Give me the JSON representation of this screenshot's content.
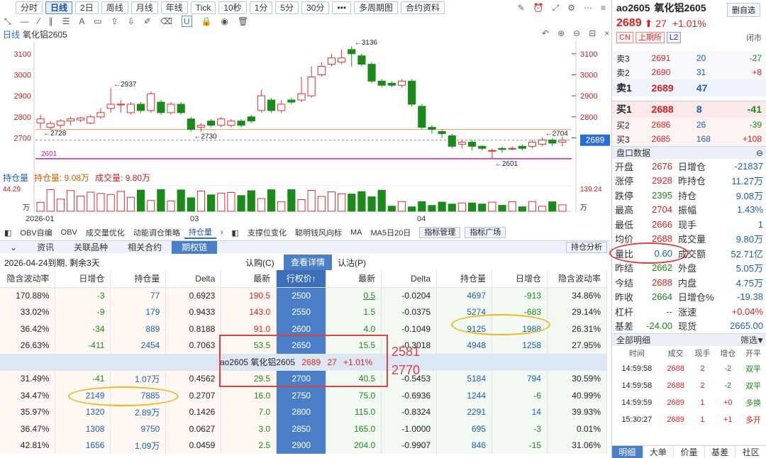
{
  "toolbar": {
    "periods": [
      "分时",
      "日线",
      "2日",
      "周线",
      "月线",
      "年线",
      "Tick",
      "10秒",
      "1分",
      "5分",
      "30分"
    ],
    "active": "日线",
    "more": "•••",
    "multi": "多周期图",
    "info": "合约资料"
  },
  "chart": {
    "type_label": "日线",
    "name": "氧化铝2605",
    "y_ticks": [
      "3100",
      "3000",
      "2900",
      "2800",
      "2700"
    ],
    "high_label": "3136",
    "lbl_2937": "2937",
    "lbl_2728": "2728",
    "lbl_2730": "2730",
    "lbl_2601": "2601",
    "lbl_2704": "2704",
    "lbl_2601b": "2601",
    "price_tag": "2689",
    "x_ticks": [
      "2026-01",
      "03",
      "04"
    ]
  },
  "chart_data": {
    "type": "candlestick",
    "title": "氧化铝2605",
    "categories_count": 46,
    "candles": [
      [
        2770,
        2790,
        2745,
        2810
      ],
      [
        2750,
        2768,
        2740,
        2780
      ],
      [
        2760,
        2780,
        2745,
        2790
      ],
      [
        2780,
        2790,
        2760,
        2800
      ],
      [
        2785,
        2795,
        2775,
        2800
      ],
      [
        2770,
        2800,
        2765,
        2810
      ],
      [
        2800,
        2820,
        2790,
        2840
      ],
      [
        2840,
        2860,
        2820,
        2937
      ],
      [
        2860,
        2860,
        2820,
        2880
      ],
      [
        2820,
        2860,
        2810,
        2870
      ],
      [
        2860,
        2830,
        2820,
        2870
      ],
      [
        2830,
        2910,
        2820,
        2920
      ],
      [
        2870,
        2820,
        2810,
        2880
      ],
      [
        2820,
        2860,
        2810,
        2870
      ],
      [
        2860,
        2820,
        2810,
        2870
      ],
      [
        2790,
        2740,
        2730,
        2800
      ],
      [
        2750,
        2760,
        2730,
        2770
      ],
      [
        2780,
        2760,
        2750,
        2790
      ],
      [
        2760,
        2790,
        2750,
        2800
      ],
      [
        2760,
        2780,
        2750,
        2790
      ],
      [
        2780,
        2760,
        2750,
        2790
      ],
      [
        2800,
        2780,
        2770,
        2810
      ],
      [
        2830,
        2900,
        2820,
        2930
      ],
      [
        2880,
        2830,
        2820,
        2890
      ],
      [
        2830,
        2860,
        2820,
        2880
      ],
      [
        2880,
        2870,
        2860,
        2890
      ],
      [
        2880,
        2910,
        2870,
        2990
      ],
      [
        2900,
        2990,
        2890,
        3040
      ],
      [
        3000,
        3040,
        2990,
        3060
      ],
      [
        3050,
        3080,
        3040,
        3100
      ],
      [
        3060,
        3080,
        3050,
        3120
      ],
      [
        3120,
        3100,
        3040,
        3136
      ],
      [
        3090,
        3050,
        3040,
        3100
      ],
      [
        3050,
        2970,
        2960,
        3060
      ],
      [
        2970,
        2950,
        2940,
        2980
      ],
      [
        2960,
        2950,
        2940,
        2970
      ],
      [
        2950,
        2970,
        2940,
        2980
      ],
      [
        2970,
        2860,
        2850,
        2980
      ],
      [
        2850,
        2750,
        2740,
        2860
      ],
      [
        2750,
        2740,
        2720,
        2760
      ],
      [
        2730,
        2720,
        2700,
        2740
      ],
      [
        2710,
        2660,
        2650,
        2720
      ],
      [
        2670,
        2680,
        2650,
        2690
      ],
      [
        2680,
        2660,
        2640,
        2690
      ],
      [
        2660,
        2650,
        2640,
        2665
      ],
      [
        2640,
        2640,
        2601,
        2650
      ],
      [
        2650,
        2645,
        2630,
        2660
      ],
      [
        2650,
        2650,
        2640,
        2660
      ],
      [
        2660,
        2650,
        2640,
        2670
      ],
      [
        2660,
        2680,
        2650,
        2690
      ],
      [
        2670,
        2690,
        2660,
        2704
      ],
      [
        2690,
        2675,
        2660,
        2700
      ],
      [
        2680,
        2689,
        2660,
        2704
      ]
    ],
    "ma_line": 2740,
    "min_line": 2601,
    "ylim": [
      2560,
      3160
    ]
  },
  "vol": {
    "title": "持仓量",
    "oi": "持仓量: 9.08万",
    "vol": "成交量: 9.80万",
    "left_top": "44.29",
    "left_unit": "万",
    "right_top": "139.24",
    "right_unit": "万"
  },
  "indicators": [
    "OBV自编",
    "OBV",
    "成交量优化",
    "动能调仓策略",
    "持仓量"
  ],
  "ind_active": "持仓量",
  "ind2": [
    "支撑位变化",
    "聪明钱风向标",
    "MA",
    "MA5日20日"
  ],
  "ind_btn1": "指标管理",
  "ind_btn2": "指标广场",
  "tabs": [
    "资讯",
    "关联品种",
    "相关合约",
    "期权链"
  ],
  "tab_active": "期权链",
  "tab_right": "持仓分析",
  "sub": {
    "expiry": "2026-04-24到期, 剩余3天",
    "call": "认购(C)",
    "detail": "查看详情",
    "put": "认沽(P)"
  },
  "cols": [
    "隐含波动率",
    "日增仓",
    "持仓量",
    "Delta",
    "最新",
    "行权价↑",
    "最新",
    "Delta",
    "持仓量",
    "日增仓",
    "隐含波动率"
  ],
  "rows": [
    [
      "170.88%",
      "-3",
      "77",
      "0.6923",
      "190.5",
      "2500",
      "0.5",
      "-0.0204",
      "4697",
      "-913",
      "34.86%"
    ],
    [
      "33.02%",
      "-9",
      "179",
      "0.9433",
      "143.0",
      "2550",
      "1.5",
      "-0.0375",
      "5274",
      "-683",
      "29.14%"
    ],
    [
      "36.42%",
      "-34",
      "889",
      "0.8188",
      "91.0",
      "2600",
      "4.0",
      "-0.1049",
      "9125",
      "1988",
      "26.31%"
    ],
    [
      "26.63%",
      "-411",
      "2454",
      "0.7063",
      "53.5",
      "2650",
      "15.5",
      "-0.3018",
      "4948",
      "1258",
      "27.95%"
    ],
    [
      "",
      "",
      "",
      "",
      "",
      "",
      "",
      "",
      "",
      "",
      ""
    ],
    [
      "31.49%",
      "-41",
      "1.07万",
      "0.4562",
      "29.5",
      "2700",
      "40.5",
      "-0.5453",
      "5184",
      "794",
      "30.59%"
    ],
    [
      "34.47%",
      "2149",
      "7885",
      "0.2707",
      "16.0",
      "2750",
      "75.0",
      "-0.6936",
      "1244",
      "-6",
      "40.99%"
    ],
    [
      "35.97%",
      "1320",
      "2.89万",
      "0.1426",
      "7.0",
      "2800",
      "115.0",
      "-0.8324",
      "2291",
      "14",
      "39.93%"
    ],
    [
      "36.47%",
      "1308",
      "9750",
      "0.0627",
      "3.0",
      "2850",
      "165.0",
      "-1.0000",
      "695",
      "-3",
      "0.01%"
    ],
    [
      "42.81%",
      "1656",
      "1.09万",
      "0.0459",
      "2.5",
      "2900",
      "204.0",
      "-0.9907",
      "846",
      "-15",
      "31.06%"
    ]
  ],
  "midbar": {
    "code": "ao2605 氧化铝2605",
    "last": "2689",
    "chg": "27",
    "pct": "+1.01%"
  },
  "annot": {
    "a": "2581",
    "b": "2770"
  },
  "right": {
    "code": "ao2605",
    "name": "氧化铝2605",
    "btn": "删自选",
    "price": "2689",
    "chg": "27",
    "pct": "+1.01%",
    "tags": [
      "CN",
      "上期所",
      "L2"
    ],
    "status": "闭市",
    "asks": [
      [
        "卖3",
        "2691",
        "20",
        "-27"
      ],
      [
        "卖2",
        "2690",
        "31",
        "+8"
      ],
      [
        "卖1",
        "2689",
        "47",
        ""
      ]
    ],
    "bids": [
      [
        "买1",
        "2688",
        "8",
        "-41"
      ],
      [
        "买2",
        "2686",
        "26",
        "-39"
      ],
      [
        "买3",
        "2685",
        "168",
        "+108"
      ]
    ],
    "sec1": "盘口数据",
    "stats": [
      [
        "开盘",
        "2676",
        "日增仓",
        "-21837"
      ],
      [
        "涨停",
        "2928",
        "昨持仓",
        "11.27万"
      ],
      [
        "跌停",
        "2395",
        "持仓",
        "9.08万"
      ],
      [
        "最高",
        "2704",
        "振幅",
        "1.43%"
      ],
      [
        "最低",
        "2666",
        "现手",
        "1"
      ],
      [
        "均价",
        "2688",
        "成交量",
        "9.80万"
      ],
      [
        "量比",
        "0.60",
        "成交额",
        "52.71亿"
      ],
      [
        "昨结",
        "2662",
        "外盘",
        "5.05万"
      ],
      [
        "今结",
        "2688",
        "内盘",
        "4.75万"
      ],
      [
        "昨收",
        "2664",
        "日增仓%",
        "-19.38"
      ],
      [
        "杠杆",
        "--",
        "涨速",
        "+0.04%"
      ],
      [
        "基差",
        "-24.00",
        "现货",
        "2665.00"
      ]
    ],
    "sec2": "全部明细",
    "filter": "筛选",
    "tick_cols": [
      "时间",
      "成交",
      "现手",
      "增仓",
      "开平"
    ],
    "ticks": [
      [
        "14:59:58",
        "2688",
        "2",
        "-2",
        "双平"
      ],
      [
        "14:59:58",
        "2688",
        "2",
        "-2",
        "双平"
      ],
      [
        "14:59:59",
        "2689",
        "1",
        "+0",
        "多换"
      ],
      [
        "15:30:27",
        "2689",
        "1",
        "+1",
        "多开"
      ]
    ],
    "btabs": [
      "明细",
      "大单",
      "价量",
      "基差",
      "社区"
    ]
  }
}
